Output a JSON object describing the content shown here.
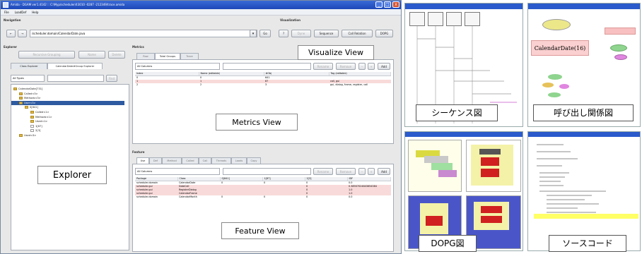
{
  "window": {
    "title": "Amida - DGAM ver1.4142 :: C:\\Myp/scheduler/43010 -0287 -212349/trace.amida",
    "min": "_",
    "max": "□",
    "close": "x"
  },
  "menu": [
    "File",
    "LoadDef",
    "Help"
  ],
  "navigation": {
    "label": "Navigation",
    "back": "←",
    "forward": "→",
    "path": "/scheduler.domain/CalendarDate.java",
    "go": "Go"
  },
  "visualization": {
    "label": "Visualization",
    "help": "?",
    "buttons": [
      "Dyne",
      "Sequence",
      "Call Relation",
      "DOPG"
    ]
  },
  "explorer": {
    "label": "Explorer",
    "recursive": "Recursive Grouping",
    "name": "Name",
    "delete": "Delete",
    "tabs": [
      "Class Explorer",
      "CalendarDate#Group Explorer"
    ],
    "filter": "All Types",
    "find": "Find",
    "tree": [
      "CalendarDate[731]",
      "Called<3>",
      "Methods<3>",
      "User<3>",
      "0[641]",
      "Called<1>",
      "Methods<1>",
      "Used<1>",
      "1[87]",
      "2[3]",
      "Used<3>"
    ]
  },
  "metrics": {
    "label": "Metrics",
    "tabs": [
      "Row",
      "Total Groups",
      "Trace"
    ],
    "filter": "All Columns",
    "rename": "Rename",
    "remove": "Remove",
    "add": "Add",
    "headers": [
      "Index",
      "Name (editable)",
      "#Obj",
      "Tag (editable)"
    ],
    "rows": [
      [
        "0",
        "0",
        "641",
        ""
      ],
      [
        "1",
        "1",
        "87",
        "call, gui"
      ],
      [
        "2",
        "2",
        "3",
        "gui, dialog, frame, register, call"
      ]
    ]
  },
  "feature": {
    "label": "Feature",
    "tabs": [
      "Use",
      "Def",
      "Method",
      "Called",
      "Call",
      "Threads",
      "Loads",
      "Copy"
    ],
    "filter": "All Columns",
    "rename": "Rename",
    "remove": "Remove",
    "add": "Add",
    "headers": [
      "Package",
      "Class",
      "0[641]",
      "1[87]",
      "2[3]",
      "IDF"
    ],
    "rows": [
      [
        "scheduler.domain",
        "CalendarDate",
        "0",
        "0",
        "0",
        "0.0"
      ],
      [
        "scheduler.gui",
        "DateCell",
        "",
        "",
        "0",
        "0.38907024643654384"
      ],
      [
        "scheduler.gui",
        "RegisterDialog",
        "",
        "",
        "0",
        "1.0"
      ],
      [
        "scheduler.gui",
        "CalendarFrame",
        "",
        "",
        "0",
        "1.0"
      ],
      [
        "scheduler.domain",
        "CalendarMonth",
        "0",
        "0",
        "0",
        "0.0"
      ]
    ]
  },
  "labels": {
    "visualize": "Visualize View",
    "metrics": "Metrics View",
    "explorer": "Explorer",
    "feature": "Feature View"
  },
  "screens": {
    "sequence": "シーケンス図",
    "call": "呼び出し関係図",
    "dopg": "DOPG図",
    "source": "ソースコード",
    "call_node": "CalendarDate(16)"
  },
  "colors": {
    "titlebar": "#1d48b8",
    "selection": "#2d5aa0",
    "highlight_row": "#f9dada",
    "yellow": "#ffff66"
  }
}
